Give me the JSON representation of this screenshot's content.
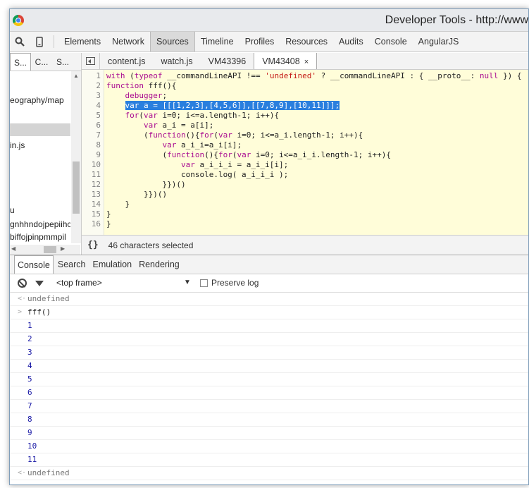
{
  "window": {
    "title": "Developer Tools - http://www"
  },
  "toolbar": {
    "tabs": [
      "Elements",
      "Network",
      "Sources",
      "Timeline",
      "Profiles",
      "Resources",
      "Audits",
      "Console",
      "AngularJS"
    ],
    "active_tab": "Sources",
    "icons": [
      "search-icon",
      "device-mode-icon"
    ]
  },
  "navigator": {
    "tabs": [
      "S...",
      "C...",
      "S..."
    ],
    "items": [
      "eography/map",
      "",
      "in.js",
      "u",
      "gnhhndojpepiihc",
      "biffojpinpmmpil"
    ],
    "selected_index": 1
  },
  "editor": {
    "tabs": [
      "content.js",
      "watch.js",
      "VM43396",
      "VM43408"
    ],
    "active_tab": "VM43408",
    "close_glyph": "×",
    "line_numbers": [
      "1",
      "2",
      "3",
      "4",
      "5",
      "6",
      "7",
      "8",
      "9",
      "10",
      "11",
      "12",
      "13",
      "14",
      "15",
      "16"
    ],
    "lines": [
      "with (typeof __commandLineAPI !== 'undefined' ? __commandLineAPI : { __proto__: null }) {",
      "function fff(){",
      "    debugger;",
      "    var a = [[[1,2,3],[4,5,6]],[[7,8,9],[10,11]]];",
      "    for(var i=0; i<=a.length-1; i++){",
      "        var a_i = a[i];",
      "        (function(){for(var i=0; i<=a_i.length-1; i++){",
      "            var a_i_i=a_i[i];",
      "            (function(){for(var i=0; i<=a_i_i.length-1; i++){",
      "                var a_i_i_i = a_i_i[i];",
      "                console.log( a_i_i_i );",
      "            }})()",
      "        }})()",
      "    }",
      "}",
      "}"
    ],
    "selected_line": 4,
    "status_icon": "{}",
    "status_text": "46 characters selected"
  },
  "drawer": {
    "tabs": [
      "Console",
      "Search",
      "Emulation",
      "Rendering"
    ],
    "active_tab": "Console",
    "frame": "<top frame>",
    "preserve_log": "Preserve log",
    "rows": [
      {
        "type": "result",
        "prefix": "<·",
        "text": "undefined"
      },
      {
        "type": "input",
        "prefix": ">",
        "text": "fff()"
      },
      {
        "type": "log",
        "prefix": "",
        "text": "1"
      },
      {
        "type": "log",
        "prefix": "",
        "text": "2"
      },
      {
        "type": "log",
        "prefix": "",
        "text": "3"
      },
      {
        "type": "log",
        "prefix": "",
        "text": "4"
      },
      {
        "type": "log",
        "prefix": "",
        "text": "5"
      },
      {
        "type": "log",
        "prefix": "",
        "text": "6"
      },
      {
        "type": "log",
        "prefix": "",
        "text": "7"
      },
      {
        "type": "log",
        "prefix": "",
        "text": "8"
      },
      {
        "type": "log",
        "prefix": "",
        "text": "9"
      },
      {
        "type": "log",
        "prefix": "",
        "text": "10"
      },
      {
        "type": "log",
        "prefix": "",
        "text": "11"
      },
      {
        "type": "result",
        "prefix": "<·",
        "text": "undefined"
      }
    ]
  }
}
